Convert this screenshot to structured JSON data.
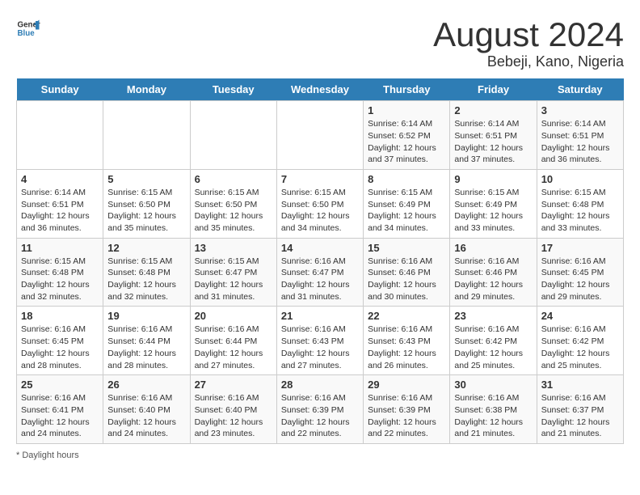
{
  "header": {
    "logo_general": "General",
    "logo_blue": "Blue",
    "main_title": "August 2024",
    "subtitle": "Bebeji, Kano, Nigeria"
  },
  "days_of_week": [
    "Sunday",
    "Monday",
    "Tuesday",
    "Wednesday",
    "Thursday",
    "Friday",
    "Saturday"
  ],
  "weeks": [
    [
      {
        "day": "",
        "info": ""
      },
      {
        "day": "",
        "info": ""
      },
      {
        "day": "",
        "info": ""
      },
      {
        "day": "",
        "info": ""
      },
      {
        "day": "1",
        "info": "Sunrise: 6:14 AM\nSunset: 6:52 PM\nDaylight: 12 hours and 37 minutes."
      },
      {
        "day": "2",
        "info": "Sunrise: 6:14 AM\nSunset: 6:51 PM\nDaylight: 12 hours and 37 minutes."
      },
      {
        "day": "3",
        "info": "Sunrise: 6:14 AM\nSunset: 6:51 PM\nDaylight: 12 hours and 36 minutes."
      }
    ],
    [
      {
        "day": "4",
        "info": "Sunrise: 6:14 AM\nSunset: 6:51 PM\nDaylight: 12 hours and 36 minutes."
      },
      {
        "day": "5",
        "info": "Sunrise: 6:15 AM\nSunset: 6:50 PM\nDaylight: 12 hours and 35 minutes."
      },
      {
        "day": "6",
        "info": "Sunrise: 6:15 AM\nSunset: 6:50 PM\nDaylight: 12 hours and 35 minutes."
      },
      {
        "day": "7",
        "info": "Sunrise: 6:15 AM\nSunset: 6:50 PM\nDaylight: 12 hours and 34 minutes."
      },
      {
        "day": "8",
        "info": "Sunrise: 6:15 AM\nSunset: 6:49 PM\nDaylight: 12 hours and 34 minutes."
      },
      {
        "day": "9",
        "info": "Sunrise: 6:15 AM\nSunset: 6:49 PM\nDaylight: 12 hours and 33 minutes."
      },
      {
        "day": "10",
        "info": "Sunrise: 6:15 AM\nSunset: 6:48 PM\nDaylight: 12 hours and 33 minutes."
      }
    ],
    [
      {
        "day": "11",
        "info": "Sunrise: 6:15 AM\nSunset: 6:48 PM\nDaylight: 12 hours and 32 minutes."
      },
      {
        "day": "12",
        "info": "Sunrise: 6:15 AM\nSunset: 6:48 PM\nDaylight: 12 hours and 32 minutes."
      },
      {
        "day": "13",
        "info": "Sunrise: 6:15 AM\nSunset: 6:47 PM\nDaylight: 12 hours and 31 minutes."
      },
      {
        "day": "14",
        "info": "Sunrise: 6:16 AM\nSunset: 6:47 PM\nDaylight: 12 hours and 31 minutes."
      },
      {
        "day": "15",
        "info": "Sunrise: 6:16 AM\nSunset: 6:46 PM\nDaylight: 12 hours and 30 minutes."
      },
      {
        "day": "16",
        "info": "Sunrise: 6:16 AM\nSunset: 6:46 PM\nDaylight: 12 hours and 29 minutes."
      },
      {
        "day": "17",
        "info": "Sunrise: 6:16 AM\nSunset: 6:45 PM\nDaylight: 12 hours and 29 minutes."
      }
    ],
    [
      {
        "day": "18",
        "info": "Sunrise: 6:16 AM\nSunset: 6:45 PM\nDaylight: 12 hours and 28 minutes."
      },
      {
        "day": "19",
        "info": "Sunrise: 6:16 AM\nSunset: 6:44 PM\nDaylight: 12 hours and 28 minutes."
      },
      {
        "day": "20",
        "info": "Sunrise: 6:16 AM\nSunset: 6:44 PM\nDaylight: 12 hours and 27 minutes."
      },
      {
        "day": "21",
        "info": "Sunrise: 6:16 AM\nSunset: 6:43 PM\nDaylight: 12 hours and 27 minutes."
      },
      {
        "day": "22",
        "info": "Sunrise: 6:16 AM\nSunset: 6:43 PM\nDaylight: 12 hours and 26 minutes."
      },
      {
        "day": "23",
        "info": "Sunrise: 6:16 AM\nSunset: 6:42 PM\nDaylight: 12 hours and 25 minutes."
      },
      {
        "day": "24",
        "info": "Sunrise: 6:16 AM\nSunset: 6:42 PM\nDaylight: 12 hours and 25 minutes."
      }
    ],
    [
      {
        "day": "25",
        "info": "Sunrise: 6:16 AM\nSunset: 6:41 PM\nDaylight: 12 hours and 24 minutes."
      },
      {
        "day": "26",
        "info": "Sunrise: 6:16 AM\nSunset: 6:40 PM\nDaylight: 12 hours and 24 minutes."
      },
      {
        "day": "27",
        "info": "Sunrise: 6:16 AM\nSunset: 6:40 PM\nDaylight: 12 hours and 23 minutes."
      },
      {
        "day": "28",
        "info": "Sunrise: 6:16 AM\nSunset: 6:39 PM\nDaylight: 12 hours and 22 minutes."
      },
      {
        "day": "29",
        "info": "Sunrise: 6:16 AM\nSunset: 6:39 PM\nDaylight: 12 hours and 22 minutes."
      },
      {
        "day": "30",
        "info": "Sunrise: 6:16 AM\nSunset: 6:38 PM\nDaylight: 12 hours and 21 minutes."
      },
      {
        "day": "31",
        "info": "Sunrise: 6:16 AM\nSunset: 6:37 PM\nDaylight: 12 hours and 21 minutes."
      }
    ]
  ],
  "footer": {
    "note": "Daylight hours"
  }
}
